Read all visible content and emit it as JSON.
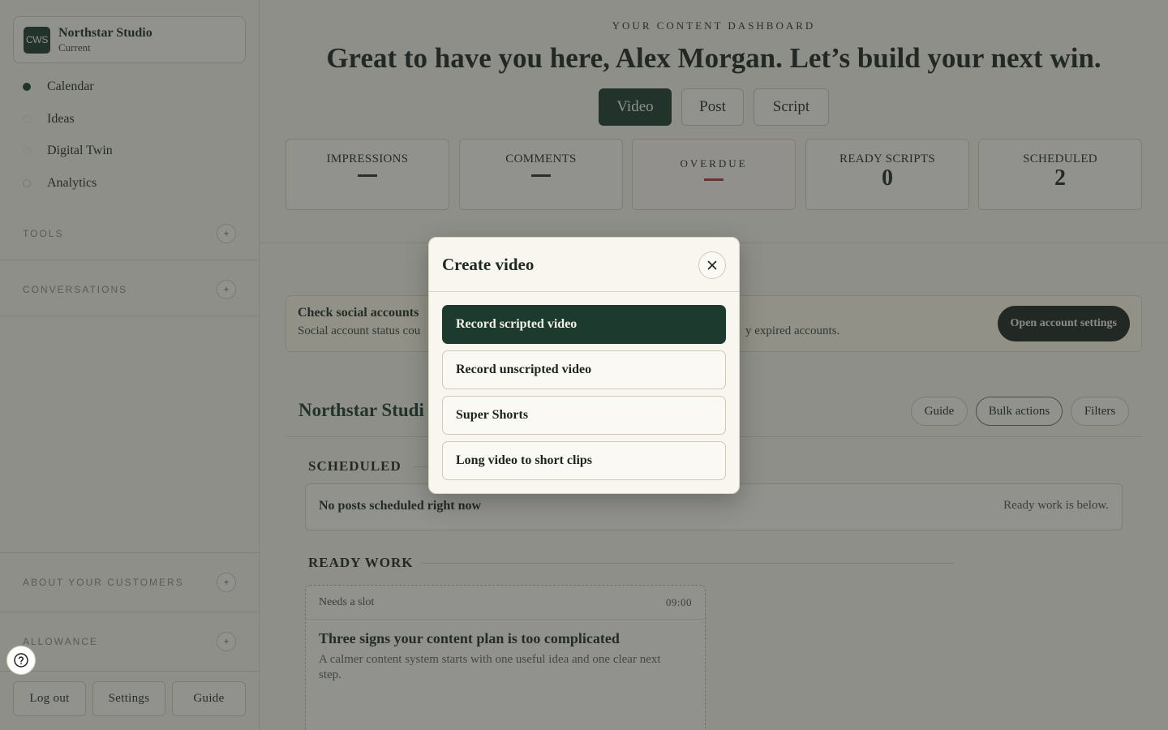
{
  "workspace": {
    "logo": "CWS",
    "name": "Northstar Studio",
    "status": "Current"
  },
  "nav": [
    "Calendar",
    "Ideas",
    "Digital Twin",
    "Analytics"
  ],
  "sidebar_sections": {
    "tools": "TOOLS",
    "conversations": "CONVERSATIONS",
    "about_customers": "ABOUT YOUR CUSTOMERS",
    "allowance": "ALLOWANCE"
  },
  "footer": {
    "logout": "Log out",
    "settings": "Settings",
    "guide": "Guide"
  },
  "header": {
    "kicker": "YOUR CONTENT DASHBOARD",
    "headline": "Great to have you here, Alex Morgan. Let’s build your next win."
  },
  "content_types": [
    "Video",
    "Post",
    "Script"
  ],
  "stats": {
    "impressions": {
      "label": "IMPRESSIONS"
    },
    "comments": {
      "label": "COMMENTS"
    },
    "overdue": {
      "label": "OVERDUE"
    },
    "ready_scripts": {
      "label": "READY SCRIPTS",
      "value": "0"
    },
    "scheduled": {
      "label": "SCHEDULED",
      "value": "2"
    }
  },
  "banner": {
    "title": "Check social accounts",
    "text_visible_start": "Social account status cou",
    "text_visible_end": "y expired accounts.",
    "button": "Open account settings"
  },
  "list": {
    "brand_title": "Northstar Studi",
    "guide": "Guide",
    "bulk": "Bulk actions",
    "filters": "Filters",
    "scheduled_head": "SCHEDULED",
    "scheduled_empty": "No posts scheduled right now",
    "scheduled_hint": "Ready work is below.",
    "ready_head": "READY WORK"
  },
  "card": {
    "tag": "Needs a slot",
    "time": "09:00",
    "title": "Three signs your content plan is too complicated",
    "desc": "A calmer content system starts with one useful idea and one clear next step."
  },
  "modal": {
    "title": "Create video",
    "options": [
      "Record scripted video",
      "Record unscripted video",
      "Super Shorts",
      "Long video to short clips"
    ]
  },
  "icons": {
    "close": "close-icon",
    "help": "help-icon",
    "plus": "plus-icon"
  },
  "colors": {
    "accent": "#1d3a2f",
    "overdue": "#b43a32",
    "background": "#f6f3ea"
  }
}
